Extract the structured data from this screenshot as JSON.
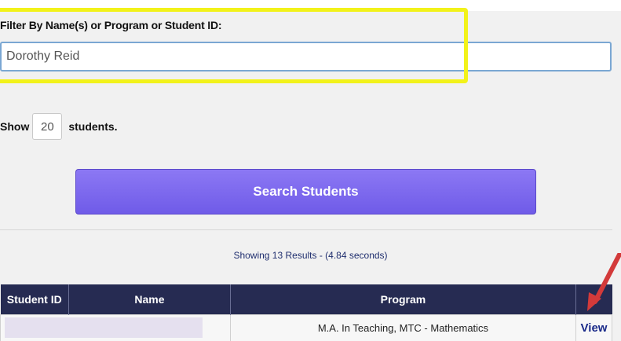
{
  "filter": {
    "label": "Filter By Name(s) or Program or Student ID:",
    "value": "Dorothy Reid"
  },
  "show": {
    "prefix": "Show",
    "count": "20",
    "suffix": "students."
  },
  "search_button_label": "Search Students",
  "results_summary": "Showing 13 Results - (4.84 seconds)",
  "table": {
    "headers": [
      "Student ID",
      "Name",
      "Program",
      ""
    ],
    "rows": [
      {
        "student_id": "",
        "name": "",
        "program": "M.A. In Teaching, MTC - Mathematics",
        "action": "View"
      }
    ]
  },
  "colors": {
    "highlight": "#f2f21a",
    "button": "#7a66ee",
    "header": "#262b52",
    "annotation_arrow": "#d33a3a"
  }
}
